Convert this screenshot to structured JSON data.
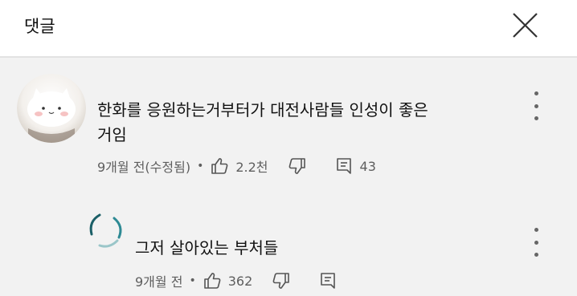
{
  "header": {
    "title": "댓글"
  },
  "comments": [
    {
      "text_line1": "한화를 응원하는거부터가 대전사람들 인성이 좋은",
      "text_line2": "거임",
      "time": "9개월 전(수정됨)",
      "likes": "2.2천",
      "replies": "43"
    },
    {
      "text_line1": "그저 살아있는 부처들",
      "time": "9개월 전",
      "likes": "362"
    }
  ],
  "icons": {
    "close": "close-icon",
    "like": "thumb-up-icon",
    "dislike": "thumb-down-icon",
    "reply": "comment-icon",
    "more": "more-vert-icon"
  }
}
